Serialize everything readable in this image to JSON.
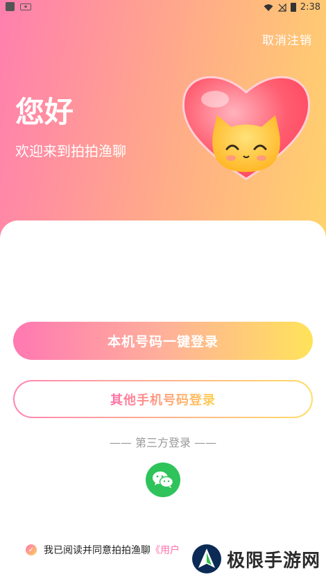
{
  "status_bar": {
    "time": "2:38"
  },
  "header": {
    "cancel_label": "取消注销",
    "greeting": "您好",
    "welcome": "欢迎来到拍拍渔聊"
  },
  "login": {
    "primary_label": "本机号码一键登录",
    "secondary_label": "其他手机号码登录",
    "third_party_label": "—— 第三方登录 ——"
  },
  "agreement": {
    "text": "我已阅读并同意拍拍渔聊",
    "link": "《用户"
  },
  "watermark": {
    "text": "极限手游网"
  },
  "colors": {
    "gradient_start": "#ff7fae",
    "gradient_end": "#ffd46b",
    "wechat_green": "#2ec35b"
  },
  "icons": [
    "wifi-icon",
    "signal-icon",
    "battery-icon",
    "heart-mascot-icon",
    "wechat-icon",
    "check-icon"
  ]
}
